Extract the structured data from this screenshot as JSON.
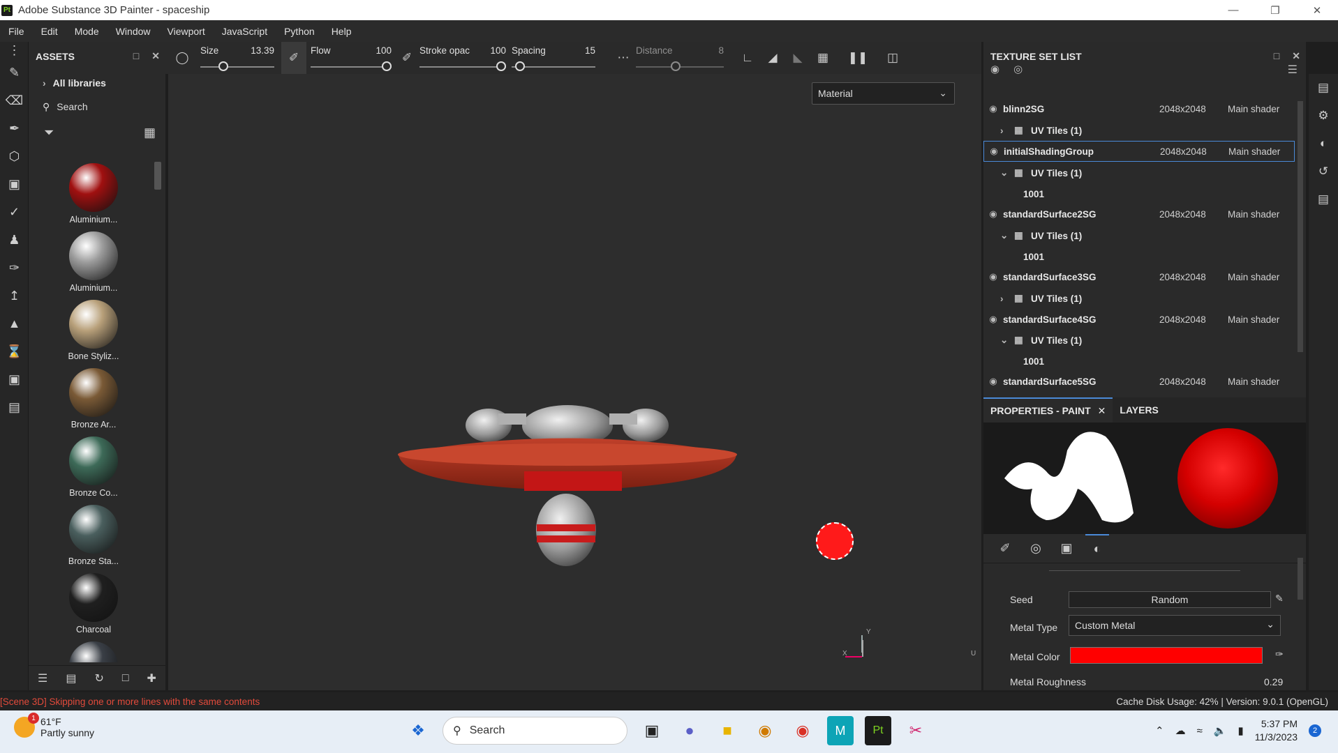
{
  "window": {
    "title": "Adobe Substance 3D Painter - spaceship",
    "logo": "Pt"
  },
  "menu": [
    "File",
    "Edit",
    "Mode",
    "Window",
    "Viewport",
    "JavaScript",
    "Python",
    "Help"
  ],
  "assets": {
    "title": "ASSETS",
    "library": "All libraries",
    "search_placeholder": "Search",
    "materials": [
      {
        "label": "Aluminium...",
        "color": "#a01010"
      },
      {
        "label": "Aluminium...",
        "color": "#9c9c9c"
      },
      {
        "label": "Bone Styliz...",
        "color": "#b8a07a"
      },
      {
        "label": "Bronze Ar...",
        "color": "#7a5a36"
      },
      {
        "label": "Bronze Co...",
        "color": "#3d6a58"
      },
      {
        "label": "Bronze Sta...",
        "color": "#4a5f5e"
      },
      {
        "label": "Charcoal",
        "color": "#1f1f1f"
      },
      {
        "label": "",
        "color": "#3a3f46"
      }
    ]
  },
  "toolbar": {
    "size": {
      "label": "Size",
      "value": "13.39",
      "fraction": 0.28
    },
    "flow": {
      "label": "Flow",
      "value": "100",
      "fraction": 1.0
    },
    "stroke_opacity": {
      "label": "Stroke opac",
      "value": "100",
      "fraction": 1.0
    },
    "spacing": {
      "label": "Spacing",
      "value": "15",
      "fraction": 0.05
    },
    "distance": {
      "label": "Distance",
      "value": "8",
      "fraction": 0.45
    }
  },
  "viewport": {
    "mode_dropdown": "Material",
    "axis_y": "Y",
    "axis_x": "X",
    "axis_u": "U"
  },
  "texture_set_list": {
    "title": "TEXTURE SET LIST",
    "sets": [
      {
        "name": "blinn2SG",
        "resolution": "2048x2048",
        "shader": "Main shader",
        "uv": "UV Tiles (1)",
        "expanded": false
      },
      {
        "name": "initialShadingGroup",
        "resolution": "2048x2048",
        "shader": "Main shader",
        "uv": "UV Tiles (1)",
        "tile": "1001",
        "expanded": true,
        "selected": true
      },
      {
        "name": "standardSurface2SG",
        "resolution": "2048x2048",
        "shader": "Main shader",
        "uv": "UV Tiles (1)",
        "tile": "1001",
        "expanded": true
      },
      {
        "name": "standardSurface3SG",
        "resolution": "2048x2048",
        "shader": "Main shader",
        "uv": "UV Tiles (1)",
        "expanded": false
      },
      {
        "name": "standardSurface4SG",
        "resolution": "2048x2048",
        "shader": "Main shader",
        "uv": "UV Tiles (1)",
        "tile": "1001",
        "expanded": true
      },
      {
        "name": "standardSurface5SG",
        "resolution": "2048x2048",
        "shader": "Main shader"
      }
    ]
  },
  "properties": {
    "tab_active": "PROPERTIES - PAINT",
    "tab_other": "LAYERS",
    "seed_label": "Seed",
    "seed_value": "Random",
    "metal_type_label": "Metal Type",
    "metal_type_value": "Custom Metal",
    "metal_color_label": "Metal Color",
    "metal_color_value": "#ff0000",
    "metal_roughness_label": "Metal Roughness",
    "metal_roughness_value": "0.29"
  },
  "status": {
    "error": "[Scene 3D] Skipping one or more lines with the same contents",
    "cache": "Cache Disk Usage:  42% | Version: 9.0.1 (OpenGL)"
  },
  "taskbar": {
    "temperature": "61°F",
    "weather": "Partly sunny",
    "weather_badge": "1",
    "search": "Search",
    "time": "5:37 PM",
    "date": "11/3/2023",
    "notifications": "2"
  }
}
